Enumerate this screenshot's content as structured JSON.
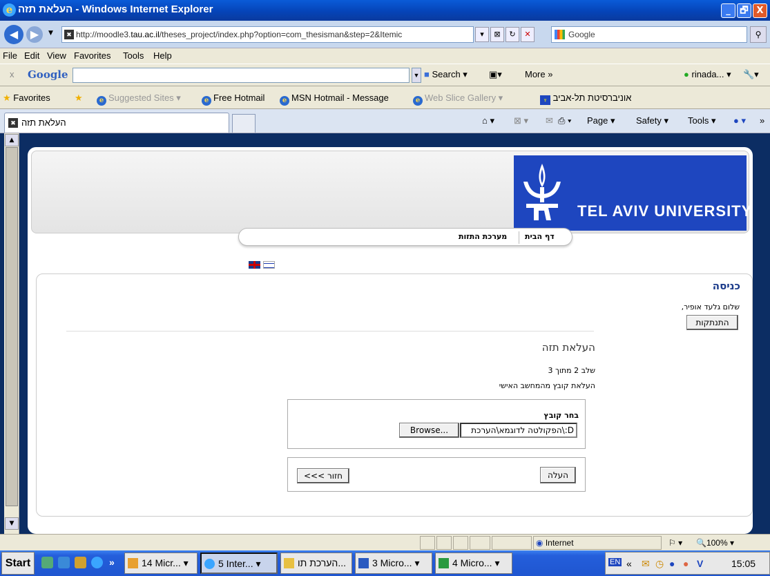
{
  "window": {
    "title": "העלאת תזה - Windows Internet Explorer",
    "min": "_",
    "max": "🗗",
    "close": "X"
  },
  "address_bar": {
    "url_prefix": "http://moodle3.",
    "url_domain": "tau.ac.il",
    "url_rest": "/theses_project/index.php?option=com_thesisman&step=2&Itemic",
    "search_placeholder": "Google"
  },
  "menu": {
    "items": [
      "File",
      "Edit",
      "View",
      "Favorites",
      "Tools",
      "Help"
    ]
  },
  "google_toolbar": {
    "close": "x",
    "logo": "Google",
    "search": "Search",
    "more": "More »",
    "user": "rinada..."
  },
  "favorites_bar": {
    "favorites": "Favorites",
    "items": [
      "Suggested Sites ▾",
      "Free Hotmail",
      "MSN Hotmail - Message",
      "Web Slice Gallery ▾",
      "אוניברסיטת תל-אביב"
    ]
  },
  "tabs": {
    "active": "העלאת תזה",
    "commands": [
      "Page ▾",
      "Safety ▾",
      "Tools ▾"
    ]
  },
  "site": {
    "logo_text": "TEL AVIV UNIVERSITY",
    "nav": [
      "דף הבית",
      "מערכת התזות"
    ]
  },
  "login": {
    "title": "כניסה",
    "greeting": "שלום גלעד אופיר,",
    "logout": "התנתקות"
  },
  "upload": {
    "title": "העלאת תזה",
    "step": "שלב 2 מתוך 3",
    "desc": "העלאת קובץ מהמחשב האישי",
    "file_label": "בחר קובץ",
    "file_value": "D:\\הפקולטה לדוגמא\\הערכת",
    "browse": "Browse...",
    "submit": "העלה",
    "back": "<<< חזור"
  },
  "statusbar": {
    "zone": "Internet",
    "zoom": "100%"
  },
  "taskbar": {
    "start": "Start",
    "buttons": [
      "14 Micr...",
      "5 Inter...",
      "הערכת תו...",
      "3 Micro...",
      "4 Micro..."
    ],
    "lang": "EN",
    "clock": "15:05"
  }
}
